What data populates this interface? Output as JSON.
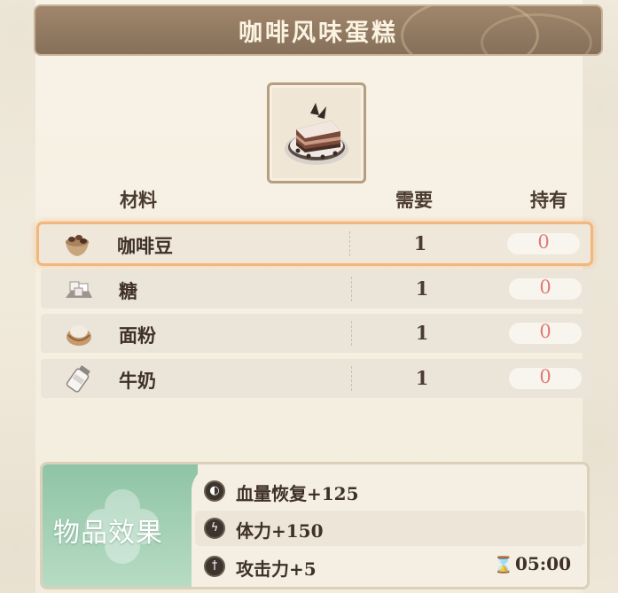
{
  "title": "咖啡风味蛋糕",
  "item_icon": "coffee-cake-icon",
  "headers": {
    "material": "材料",
    "need": "需要",
    "have": "持有"
  },
  "materials": [
    {
      "name": "咖啡豆",
      "icon": "coffee-beans-icon",
      "need": "1",
      "have": "0",
      "selected": true
    },
    {
      "name": "糖",
      "icon": "sugar-icon",
      "need": "1",
      "have": "0",
      "selected": false
    },
    {
      "name": "面粉",
      "icon": "flour-icon",
      "need": "1",
      "have": "0",
      "selected": false
    },
    {
      "name": "牛奶",
      "icon": "milk-icon",
      "need": "1",
      "have": "0",
      "selected": false
    }
  ],
  "effect": {
    "label": "物品效果",
    "items": [
      {
        "icon": "hp-icon",
        "text": "血量恢复+125"
      },
      {
        "icon": "stamina-icon",
        "text": "体力+150"
      },
      {
        "icon": "attack-icon",
        "text": "攻击力+5"
      }
    ],
    "duration": "05:00"
  },
  "colors": {
    "accent": "#f1b77c",
    "owned_zero": "#e07a76",
    "title_bg": "#8f7761",
    "effect_green": "#9fcfb2"
  }
}
